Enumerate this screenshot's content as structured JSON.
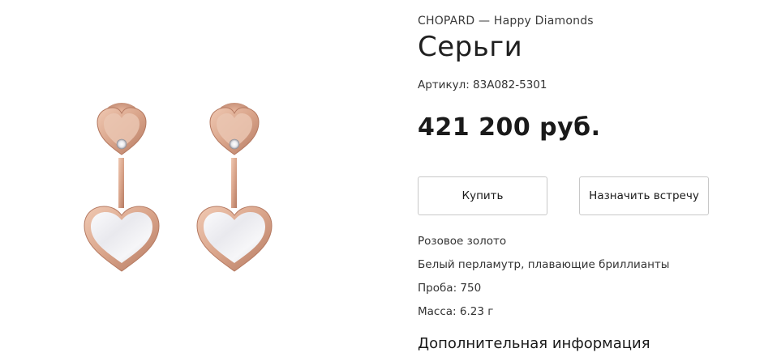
{
  "product": {
    "brand_line": "CHOPARD — Happy Diamonds",
    "title": "Серьги",
    "article": "Артикул: 83A082-5301",
    "price": "421 200 руб.",
    "image_icon": "earrings-image"
  },
  "actions": {
    "buy_label": "Купить",
    "appointment_label": "Назначить встречу"
  },
  "specs": [
    "Розовое золото",
    "Белый перламутр, плавающие бриллианты",
    "Проба: 750",
    "Масса: 6.23 г"
  ],
  "more_info_label": "Дополнительная информация",
  "colors": {
    "rose_gold": "#d9a48a",
    "rose_gold_dark": "#b57a62",
    "mother_of_pearl": "#f1f1f3",
    "button_border": "#c8c8c8"
  }
}
